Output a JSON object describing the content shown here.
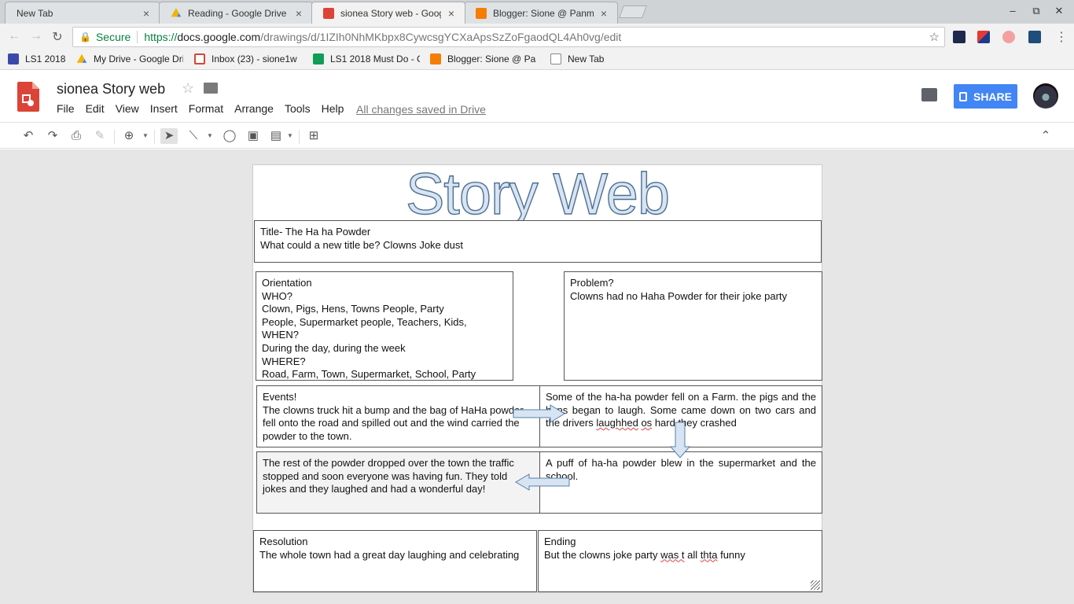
{
  "browser": {
    "tabs": [
      {
        "label": "New Tab",
        "active": false
      },
      {
        "label": "Reading - Google Drive",
        "active": false
      },
      {
        "label": "sionea Story web - Googl",
        "active": true
      },
      {
        "label": "Blogger: Sione @ Panmu",
        "active": false
      }
    ],
    "tab_close_glyph": "×",
    "omnibox": {
      "secure_label": "Secure",
      "url_scheme": "https://",
      "url_host": "docs.google.com",
      "url_path": "/drawings/d/1IZIh0NhMKbpx8CywcsgYCXaApsSzZoFgaodQL4Ah0vg/edit"
    },
    "bookmarks": [
      {
        "label": "LS1 2018",
        "icon": "calendar-icon",
        "color": "#3b4aa8"
      },
      {
        "label": "My Drive - Google Dri",
        "icon": "drive-icon",
        "color": "#f4b400"
      },
      {
        "label": "Inbox (23) - sione1w",
        "icon": "gmail-icon",
        "color": "#d44638"
      },
      {
        "label": "LS1 2018 Must Do - G",
        "icon": "sheets-icon",
        "color": "#0f9d58"
      },
      {
        "label": "Blogger: Sione @ Pa",
        "icon": "blogger-icon",
        "color": "#f57d00"
      },
      {
        "label": "New Tab",
        "icon": "page-icon",
        "color": "#888888"
      }
    ]
  },
  "docs": {
    "title": "sionea Story web",
    "menus": [
      "File",
      "Edit",
      "View",
      "Insert",
      "Format",
      "Arrange",
      "Tools",
      "Help"
    ],
    "save_status": "All changes saved in Drive",
    "share_label": "SHARE",
    "colors": {
      "share": "#4285f4",
      "logo_red": "#db4437"
    }
  },
  "drawing": {
    "heading": "Story Web",
    "title_box": {
      "lines": [
        "Title- The Ha ha Powder",
        "What could a new title be?  Clowns Joke dust"
      ]
    },
    "orientation": {
      "lines": [
        "Orientation",
        "WHO?",
        "Clown, Pigs, Hens, Towns People, Party",
        "People, Supermarket people, Teachers, Kids,",
        "WHEN?",
        "During the day, during the week",
        "WHERE?",
        "Road, Farm, Town, Supermarket, School, Party"
      ]
    },
    "problem": {
      "heading": "Problem?",
      "text": "Clowns had no Haha Powder for their joke party"
    },
    "events": {
      "heading": "Events!",
      "text": "The clowns truck hit a bump and the bag of HaHa powder fell onto the road and spilled out and the wind carried the powder to the town."
    },
    "farm": {
      "text_a": "Some of the ha-ha powder fell on a Farm. the   pigs and the hens began to laugh. Some came down on two cars and the drivers",
      "w_laughed": "laughhed",
      "w_as": "os",
      "text_b": "hard they crashed"
    },
    "town": {
      "text": "The rest of the powder dropped over the town the traffic stopped and soon everyone was having fun. They told jokes and they laughed and had a wonderful day!"
    },
    "puff": {
      "text": "A puff of ha-ha powder blew in the supermarket and the school."
    },
    "resolution": {
      "heading": "Resolution",
      "text": "The whole town had a great day laughing and celebrating"
    },
    "ending": {
      "heading": "Ending",
      "text_a": "But the clowns joke party",
      "w_wast": "was t",
      "text_b": "all",
      "w_thta": "thta",
      "text_c": "funny"
    },
    "arrow_colors": {
      "fill": "#d6e4f3",
      "stroke": "#5b7fa6"
    }
  }
}
